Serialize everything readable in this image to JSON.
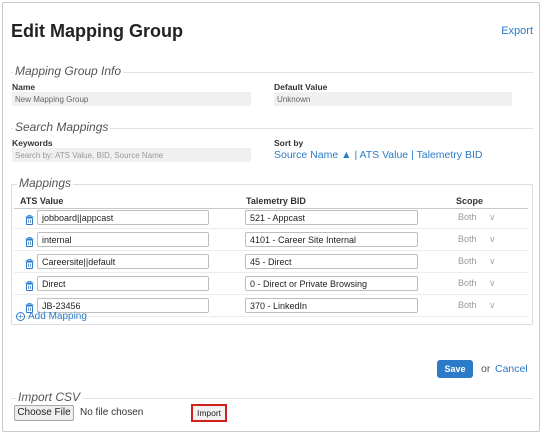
{
  "header": {
    "title": "Edit Mapping Group",
    "export_label": "Export"
  },
  "info": {
    "legend": "Mapping Group Info",
    "name_label": "Name",
    "name_value": "New Mapping Group",
    "default_label": "Default Value",
    "default_value": "Unknown"
  },
  "search": {
    "legend": "Search Mappings",
    "keywords_label": "Keywords",
    "keywords_placeholder": "Search by: ATS Value, BID, Source Name",
    "sort_label": "Sort by",
    "sort_options": [
      "Source Name ▲",
      "ATS Value",
      "Talemetry BID"
    ],
    "separator": "|"
  },
  "mappings": {
    "legend": "Mappings",
    "columns": {
      "ats": "ATS Value",
      "bid": "Talemetry BID",
      "scope": "Scope"
    },
    "rows": [
      {
        "ats": "jobboard||appcast",
        "bid": "521 - Appcast",
        "scope": "Both"
      },
      {
        "ats": "internal",
        "bid": "4101 - Career Site Internal",
        "scope": "Both"
      },
      {
        "ats": "Careersite||default",
        "bid": "45 - Direct",
        "scope": "Both"
      },
      {
        "ats": "Direct",
        "bid": "0 - Direct or Private Browsing",
        "scope": "Both"
      },
      {
        "ats": "JB-23456",
        "bid": "370 - LinkedIn",
        "scope": "Both"
      }
    ],
    "add_label": "Add Mapping"
  },
  "actions": {
    "save_label": "Save",
    "or_text": "or",
    "cancel_label": "Cancel"
  },
  "import": {
    "legend": "Import CSV",
    "choose_label": "Choose File",
    "file_status": "No file chosen",
    "import_label": "Import"
  },
  "icons": {
    "row_icon": "trash-icon",
    "add_icon": "plus-circle-icon",
    "dropdown_icon": "chevron-down-icon"
  },
  "colors": {
    "accent": "#2b7bc8",
    "highlight": "#d0201e"
  }
}
